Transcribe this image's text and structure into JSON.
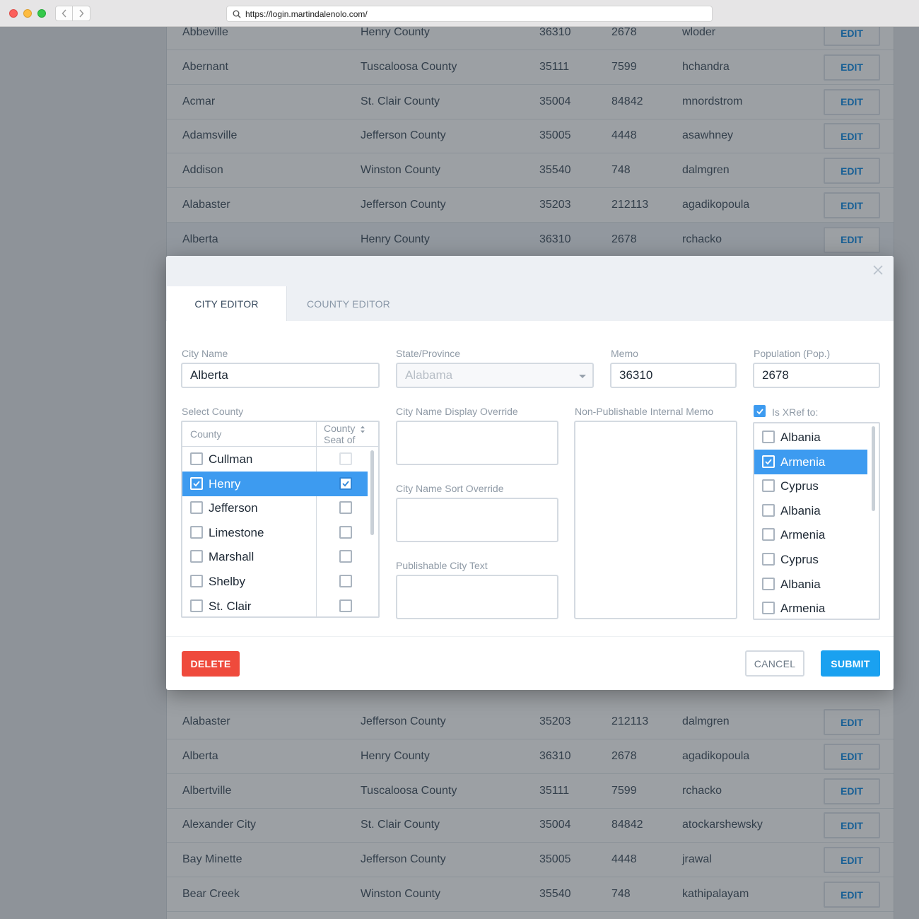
{
  "browser": {
    "url": "https://login.martindalenolo.com/"
  },
  "table_top": [
    {
      "city": "Abbeville",
      "county": "Henry County",
      "zip": "36310",
      "pop": "2678",
      "user": "wloder",
      "edit": "EDIT"
    },
    {
      "city": "Abernant",
      "county": "Tuscaloosa County",
      "zip": "35111",
      "pop": "7599",
      "user": "hchandra",
      "edit": "EDIT"
    },
    {
      "city": "Acmar",
      "county": "St. Clair County",
      "zip": "35004",
      "pop": "84842",
      "user": "mnordstrom",
      "edit": "EDIT"
    },
    {
      "city": "Adamsville",
      "county": "Jefferson County",
      "zip": "35005",
      "pop": "4448",
      "user": "asawhney",
      "edit": "EDIT"
    },
    {
      "city": "Addison",
      "county": "Winston County",
      "zip": "35540",
      "pop": "748",
      "user": "dalmgren",
      "edit": "EDIT"
    },
    {
      "city": "Alabaster",
      "county": "Jefferson County",
      "zip": "35203",
      "pop": "212113",
      "user": "agadikopoula",
      "edit": "EDIT"
    },
    {
      "city": "Alberta",
      "county": "Henry County",
      "zip": "36310",
      "pop": "2678",
      "user": "rchacko",
      "edit": "EDIT"
    }
  ],
  "table_bottom": [
    {
      "city": "Alabaster",
      "county": "Jefferson County",
      "zip": "35203",
      "pop": "212113",
      "user": "dalmgren",
      "edit": "EDIT"
    },
    {
      "city": "Alberta",
      "county": "Henry County",
      "zip": "36310",
      "pop": "2678",
      "user": "agadikopoula",
      "edit": "EDIT"
    },
    {
      "city": "Albertville",
      "county": "Tuscaloosa County",
      "zip": "35111",
      "pop": "7599",
      "user": "rchacko",
      "edit": "EDIT"
    },
    {
      "city": "Alexander City",
      "county": "St. Clair County",
      "zip": "35004",
      "pop": "84842",
      "user": "atockarshewsky",
      "edit": "EDIT"
    },
    {
      "city": "Bay Minette",
      "county": "Jefferson County",
      "zip": "35005",
      "pop": "4448",
      "user": "jrawal",
      "edit": "EDIT"
    },
    {
      "city": "Bear Creek",
      "county": "Winston County",
      "zip": "35540",
      "pop": "748",
      "user": "kathipalayam",
      "edit": "EDIT"
    }
  ],
  "modal": {
    "tabs": {
      "city": "CITY EDITOR",
      "county": "COUNTY EDITOR"
    },
    "labels": {
      "city_name": "City Name",
      "state": "State/Province",
      "memo": "Memo",
      "population": "Population (Pop.)",
      "select_county": "Select County",
      "display_override": "City Name Display Override",
      "sort_override": "City Name Sort Override",
      "publishable_text": "Publishable City Text",
      "internal_memo": "Non-Publishable Internal Memo",
      "xref": "Is XRef to:"
    },
    "values": {
      "city_name": "Alberta",
      "state": "Alabama",
      "memo": "36310",
      "population": "2678"
    },
    "county_list": {
      "header_county": "County",
      "header_seat": "County Seat of",
      "items": [
        {
          "name": "Cullman",
          "checked": false,
          "seat": false
        },
        {
          "name": "Henry",
          "checked": true,
          "seat": true
        },
        {
          "name": "Jefferson",
          "checked": false,
          "seat": false
        },
        {
          "name": "Limestone",
          "checked": false,
          "seat": false
        },
        {
          "name": "Marshall",
          "checked": false,
          "seat": false
        },
        {
          "name": "Shelby",
          "checked": false,
          "seat": false
        },
        {
          "name": "St. Clair",
          "checked": false,
          "seat": false
        }
      ]
    },
    "xref_checked": true,
    "xref_list": [
      {
        "name": "Albania",
        "checked": false
      },
      {
        "name": "Armenia",
        "checked": true
      },
      {
        "name": "Cyprus",
        "checked": false
      },
      {
        "name": "Albania",
        "checked": false
      },
      {
        "name": "Armenia",
        "checked": false
      },
      {
        "name": "Cyprus",
        "checked": false
      },
      {
        "name": "Albania",
        "checked": false
      },
      {
        "name": "Armenia",
        "checked": false
      }
    ],
    "buttons": {
      "delete": "DELETE",
      "cancel": "CANCEL",
      "submit": "SUBMIT"
    }
  },
  "colors": {
    "accent": "#3d9bf0",
    "danger": "#ef4a3c",
    "submit": "#1aa1f0",
    "edit_text": "#1b8fe6"
  }
}
